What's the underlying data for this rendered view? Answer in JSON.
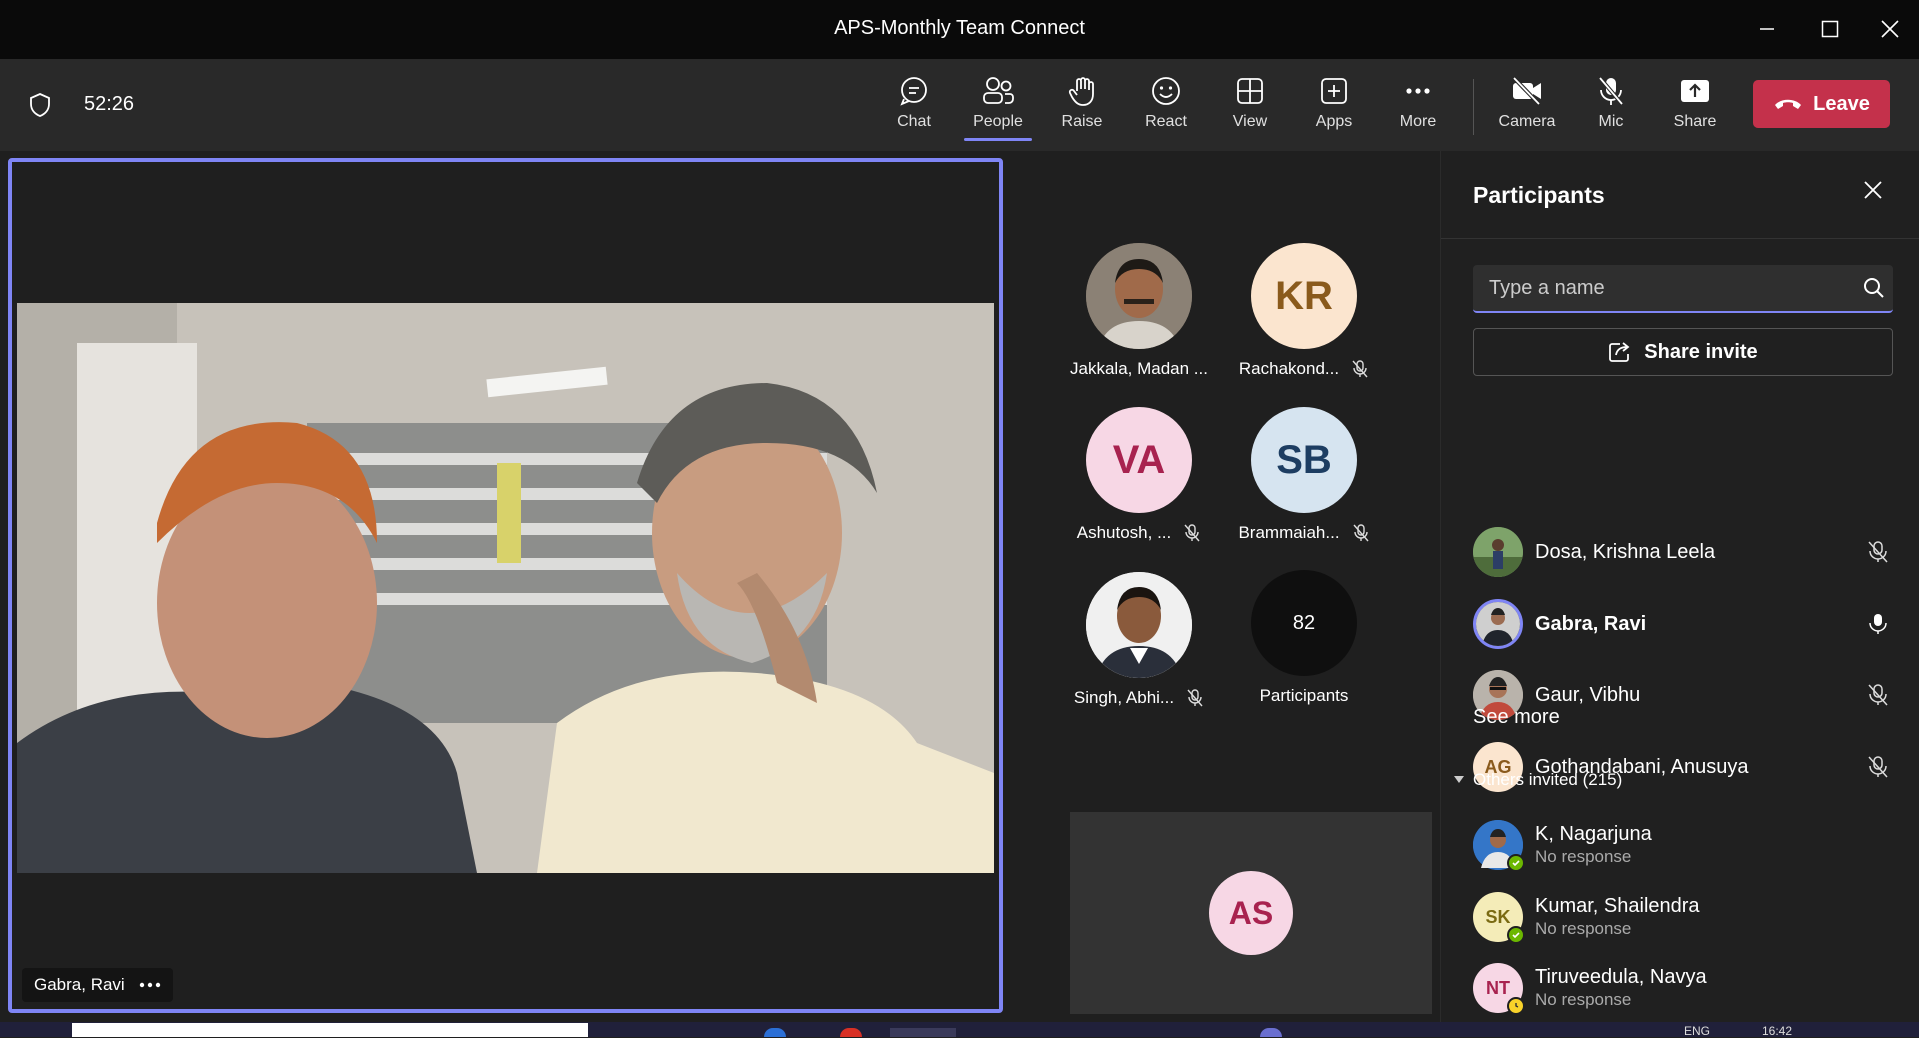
{
  "window": {
    "title": "APS-Monthly Team Connect"
  },
  "toolbar": {
    "timer": "52:26",
    "buttons": [
      {
        "id": "chat",
        "label": "Chat",
        "icon": "chat-icon"
      },
      {
        "id": "people",
        "label": "People",
        "icon": "people-icon",
        "active": true
      },
      {
        "id": "raise",
        "label": "Raise",
        "icon": "hand-icon"
      },
      {
        "id": "react",
        "label": "React",
        "icon": "smile-icon"
      },
      {
        "id": "view",
        "label": "View",
        "icon": "grid-icon"
      },
      {
        "id": "apps",
        "label": "Apps",
        "icon": "plus-box-icon"
      },
      {
        "id": "more",
        "label": "More",
        "icon": "ellipsis-icon"
      },
      {
        "id": "camera",
        "label": "Camera",
        "icon": "camera-off-icon"
      },
      {
        "id": "mic",
        "label": "Mic",
        "icon": "mic-off-icon"
      },
      {
        "id": "share",
        "label": "Share",
        "icon": "share-up-icon"
      }
    ],
    "leave_label": "Leave",
    "accent": "#7f85f5",
    "leave_color": "#c4314b"
  },
  "stage": {
    "main_video_name": "Gabra, Ravi",
    "tiles": [
      {
        "name": "Jakkala, Madan ...",
        "initials": "",
        "photo": true,
        "muted": false
      },
      {
        "name": "Rachakond...",
        "initials": "KR",
        "bg": "#fbe5cf",
        "fg": "#8a5a1c",
        "muted": true
      },
      {
        "name": "Ashutosh, ...",
        "initials": "VA",
        "bg": "#f7d7e5",
        "fg": "#a8224f",
        "muted": true
      },
      {
        "name": "Brammaiah...",
        "initials": "SB",
        "bg": "#d6e4f0",
        "fg": "#1d3d62",
        "muted": true
      },
      {
        "name": "Singh, Abhi...",
        "initials": "",
        "photo": true,
        "muted": true
      },
      {
        "name": "Participants",
        "count": "82",
        "muted": false
      }
    ],
    "self_tile_initials": "AS"
  },
  "participants": {
    "title": "Participants",
    "search_placeholder": "Type a name",
    "share_invite": "Share invite",
    "in_meeting": [
      {
        "name": "Dosa, Krishna Leela",
        "initials": "",
        "photo": true,
        "mic": "muted"
      },
      {
        "name": "Gabra, Ravi",
        "initials": "",
        "photo": true,
        "mic": "on",
        "speaking": true
      },
      {
        "name": "Gaur, Vibhu",
        "initials": "",
        "photo": true,
        "mic": "muted"
      },
      {
        "name": "Gothandabani, Anusuya",
        "initials": "AG",
        "bg": "#fbe5cf",
        "fg": "#8a5a1c",
        "mic": "muted"
      }
    ],
    "see_more": "See more",
    "others_invited": "Others invited (215)",
    "invited": [
      {
        "name": "K, Nagarjuna",
        "status": "No response",
        "photo": true,
        "badge": "available"
      },
      {
        "name": "Kumar, Shailendra",
        "status": "No response",
        "initials": "SK",
        "bg": "#f4ecb8",
        "fg": "#7a6a12",
        "badge": "available"
      },
      {
        "name": "Tiruveedula, Navya",
        "status": "No response",
        "initials": "NT",
        "bg": "#f7d7e5",
        "fg": "#a8224f",
        "badge": "away"
      }
    ]
  },
  "taskbar": {
    "lang": "ENG",
    "time": "16:42"
  }
}
